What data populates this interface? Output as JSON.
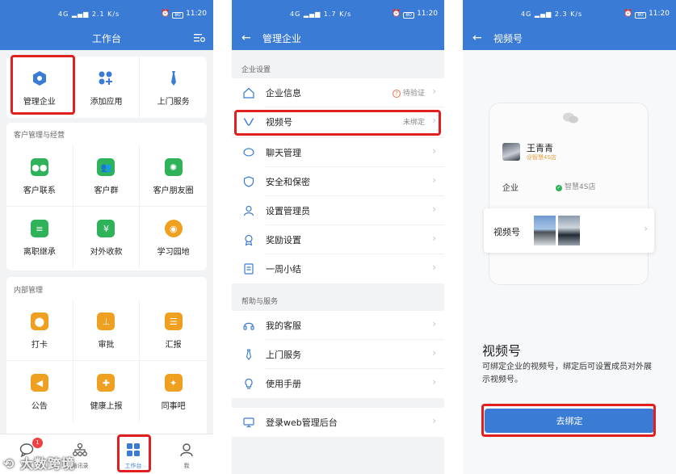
{
  "status": {
    "signal": "4G",
    "speed": "2.1 K/s",
    "speed2": "1.7 K/s",
    "speed3": "2.3 K/s",
    "battery": "80",
    "time": "11:20"
  },
  "screen1": {
    "title": "工作台",
    "top_apps": [
      {
        "label": "管理企业",
        "icon": "hexagon-icon",
        "color": "#3a7bd5"
      },
      {
        "label": "添加应用",
        "icon": "add-apps-icon",
        "color": "#3a7bd5"
      },
      {
        "label": "上门服务",
        "icon": "tie-icon",
        "color": "#3a7bd5"
      }
    ],
    "section_customer": "客户管理与经营",
    "customer_apps": [
      {
        "label": "客户联系",
        "icon": "chat-bubble-icon",
        "color": "#2fb35a"
      },
      {
        "label": "客户群",
        "icon": "group-icon",
        "color": "#2fb35a"
      },
      {
        "label": "客户朋友圈",
        "icon": "aperture-icon",
        "color": "#2fb35a"
      },
      {
        "label": "离职继承",
        "icon": "document-icon",
        "color": "#2fb35a"
      },
      {
        "label": "对外收款",
        "icon": "yen-icon",
        "color": "#2fb35a"
      },
      {
        "label": "学习园地",
        "icon": "planet-icon",
        "color": "#f0a020"
      }
    ],
    "section_internal": "内部管理",
    "internal_apps": [
      {
        "label": "打卡",
        "icon": "location-pin-icon",
        "color": "#f0a020"
      },
      {
        "label": "审批",
        "icon": "stamp-icon",
        "color": "#f0a020"
      },
      {
        "label": "汇报",
        "icon": "report-icon",
        "color": "#f0a020"
      },
      {
        "label": "公告",
        "icon": "megaphone-icon",
        "color": "#f0a020"
      },
      {
        "label": "健康上报",
        "icon": "health-icon",
        "color": "#f0a020"
      },
      {
        "label": "同事吧",
        "icon": "share-icon",
        "color": "#f0a020"
      }
    ],
    "tabs": [
      {
        "label": "消息",
        "badge": "1"
      },
      {
        "label": "通讯录",
        "badge": ""
      },
      {
        "label": "工作台",
        "badge": ""
      },
      {
        "label": "我",
        "badge": ""
      }
    ]
  },
  "screen2": {
    "title": "管理企业",
    "section_settings": "企业设置",
    "settings": [
      {
        "label": "企业信息",
        "value": "待验证",
        "icon": "home-icon"
      },
      {
        "label": "视频号",
        "value": "未绑定",
        "icon": "channels-icon"
      },
      {
        "label": "聊天管理",
        "value": "",
        "icon": "chat-icon"
      },
      {
        "label": "安全和保密",
        "value": "",
        "icon": "shield-icon"
      },
      {
        "label": "设置管理员",
        "value": "",
        "icon": "user-icon"
      },
      {
        "label": "奖励设置",
        "value": "",
        "icon": "medal-icon"
      },
      {
        "label": "一周小结",
        "value": "",
        "icon": "summary-icon"
      }
    ],
    "section_help": "帮助与服务",
    "help": [
      {
        "label": "我的客服",
        "icon": "headset-icon"
      },
      {
        "label": "上门服务",
        "icon": "tie-icon"
      },
      {
        "label": "使用手册",
        "icon": "bulb-icon"
      }
    ],
    "web_admin": {
      "label": "登录web管理后台",
      "icon": "monitor-icon"
    }
  },
  "screen3": {
    "title": "视频号",
    "profile_name": "王青青",
    "profile_org": "@智慧4S店",
    "company_label": "企业",
    "company_value": "智慧4S店",
    "channel_label": "视频号",
    "heading": "视频号",
    "description": "可绑定企业的视频号，绑定后可设置成员对外展示视频号。",
    "unbind_button": "去绑定"
  },
  "watermark": "大数跨境",
  "colors": {
    "brand": "#3a7bd5",
    "highlight": "#e02020",
    "green": "#2fb35a",
    "orange": "#f0a020"
  }
}
